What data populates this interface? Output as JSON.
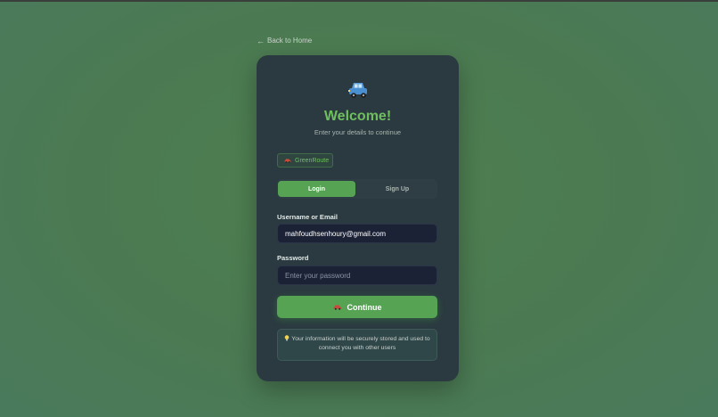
{
  "nav": {
    "back_arrow_icon": "arrow-left-icon",
    "back_label": "Back to Home"
  },
  "card": {
    "hero_icon": "car-icon",
    "title": "Welcome!",
    "subtitle": "Enter your details to continue",
    "brand": {
      "icon": "car-icon",
      "label": "GreenRoute"
    },
    "tabs": [
      {
        "label": "Login",
        "active": true
      },
      {
        "label": "Sign Up",
        "active": false
      }
    ],
    "username": {
      "label": "Username or Email",
      "value": "mahfoudhsenhoury@gmail.com"
    },
    "password": {
      "label": "Password",
      "placeholder": "Enter your password",
      "value": ""
    },
    "continue": {
      "icon": "car-icon",
      "label": "Continue"
    },
    "info": {
      "icon": "lightbulb-icon",
      "text": "Your information will be securely stored and used to connect you with other users"
    }
  },
  "colors": {
    "background": "#4e7d52",
    "card": "#2b3a40",
    "accent": "#57a354",
    "title": "#6fbf5f",
    "input_bg": "#1c2236"
  }
}
